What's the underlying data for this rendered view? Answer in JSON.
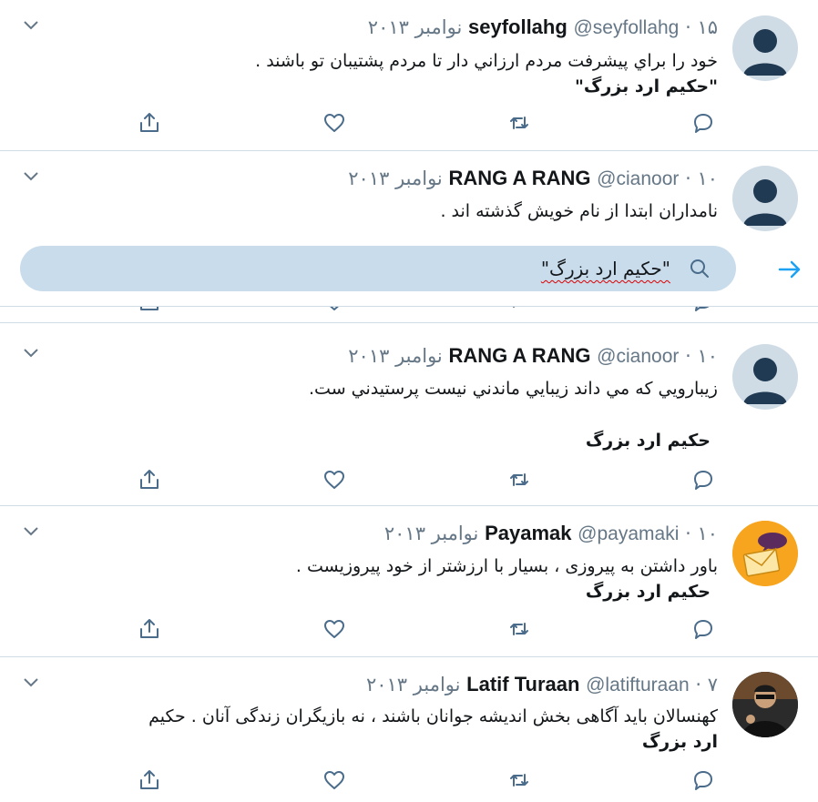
{
  "search": {
    "query": "\"حکیم ارد بزرگ\""
  },
  "tweets": [
    {
      "name": "seyfollahg",
      "handle": "@seyfollahg",
      "date": "۱۵ نوامبر ۲۰۱۳",
      "lines": [
        "خود را براي پيشرفت مردم ارزاني دار تا مردم پشتيبان تو باشند .",
        "\"حکیم ارد بزرگ\""
      ]
    },
    {
      "name": "RANG A RANG",
      "handle": "@cianoor",
      "date": "۱۰ نوامبر ۲۰۱۳",
      "lines": [
        "نامداران ابتدا از نام خويش گذشته اند ."
      ]
    },
    {
      "name": "RANG A RANG",
      "handle": "@cianoor",
      "date": "۱۰ نوامبر ۲۰۱۳",
      "lines": [
        "زيبارويي كه مي داند زيبايي ماندني نيست پرستيدني ست.",
        "حکیم ارد بزرگ"
      ]
    },
    {
      "name": "Payamak",
      "handle": "@payamaki",
      "date": "۱۰ نوامبر ۲۰۱۳",
      "lines": [
        "باور داشتن به پیروزی ، بسیار با ارزشتر از خود پیروزیست .",
        "حکیم ارد بزرگ"
      ]
    },
    {
      "name": "Latif Turaan",
      "handle": "@latifturaan",
      "date": "۷ نوامبر ۲۰۱۳",
      "lines": [
        "کهنسالان باید آگاهی بخش اندیشه جوانان باشند ، نه بازیگران زندگی آنان .  حکیم",
        "ارد بزرگ"
      ]
    }
  ],
  "separator": "·",
  "colors": {
    "accent": "#1da1f2",
    "icon": "#4a6b8a",
    "border": "#cfdbe5",
    "search_bg": "#c9dcec"
  }
}
